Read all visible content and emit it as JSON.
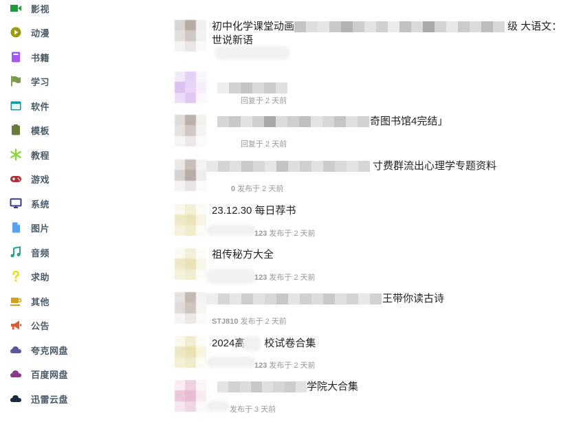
{
  "sidebar": {
    "items": [
      {
        "label": "影视",
        "icon": "video-camera-icon",
        "color": "#1a9e3a"
      },
      {
        "label": "动漫",
        "icon": "play-circle-icon",
        "color": "#9a9a12"
      },
      {
        "label": "书籍",
        "icon": "book-icon",
        "color": "#a855f7"
      },
      {
        "label": "学习",
        "icon": "flag-icon",
        "color": "#7a9a4a"
      },
      {
        "label": "软件",
        "icon": "window-icon",
        "color": "#0f9aa0"
      },
      {
        "label": "模板",
        "icon": "clipboard-icon",
        "color": "#6a7a3a"
      },
      {
        "label": "教程",
        "icon": "snowflake-icon",
        "color": "#8ad53a"
      },
      {
        "label": "游戏",
        "icon": "gamepad-icon",
        "color": "#b0303a"
      },
      {
        "label": "系统",
        "icon": "monitor-icon",
        "color": "#3a3a8a"
      },
      {
        "label": "图片",
        "icon": "file-image-icon",
        "color": "#5aa0f0"
      },
      {
        "label": "音频",
        "icon": "music-note-icon",
        "color": "#2aa090"
      },
      {
        "label": "求助",
        "icon": "question-mark-icon",
        "color": "#e0e020"
      },
      {
        "label": "其他",
        "icon": "coffee-cup-icon",
        "color": "#d0a020"
      },
      {
        "label": "公告",
        "icon": "megaphone-icon",
        "color": "#e05a30"
      },
      {
        "label": "夸克网盘",
        "icon": "cloud-icon",
        "color": "#5a5a9a"
      },
      {
        "label": "百度网盘",
        "icon": "cloud-icon",
        "color": "#8a3a8a"
      },
      {
        "label": "迅雷云盘",
        "icon": "cloud-icon",
        "color": "#1a2a3a"
      }
    ]
  },
  "topics": [
    {
      "title": "初中化学课堂动画",
      "title_tail": "级 大语文：世说新语",
      "meta_user": "",
      "meta_text": ""
    },
    {
      "title": "",
      "title_tail": "",
      "meta_user": "",
      "meta_text": "回复于 2 天前"
    },
    {
      "title": "",
      "title_tail": "奇图书馆4完结」",
      "meta_user": "",
      "meta_text": "回复于 2 天前"
    },
    {
      "title": "",
      "title_tail": "寸费群流出心理学专题资料",
      "meta_user": "0",
      "meta_text": "发布于 2 天前"
    },
    {
      "title": "23.12.30 每日荐书",
      "title_tail": "",
      "meta_user": "123",
      "meta_text": "发布于 2 天前"
    },
    {
      "title": "祖传秘方大全",
      "title_tail": "",
      "meta_user": "123",
      "meta_text": "发布于 2 天前"
    },
    {
      "title": "",
      "title_tail": "王带你读古诗",
      "meta_user": "STJ810",
      "meta_text": "发布于 2 天前"
    },
    {
      "title": "2024高",
      "title_tail": "校试卷合集",
      "meta_user": "123",
      "meta_text": "发布于 2 天前"
    },
    {
      "title": "",
      "title_tail": "学院大合集",
      "meta_user": "",
      "meta_text": "发布于 3 天前"
    }
  ],
  "colors": {
    "sidebar_label": "#4a5a6a",
    "title": "#222222",
    "meta": "#9a9a9a"
  }
}
